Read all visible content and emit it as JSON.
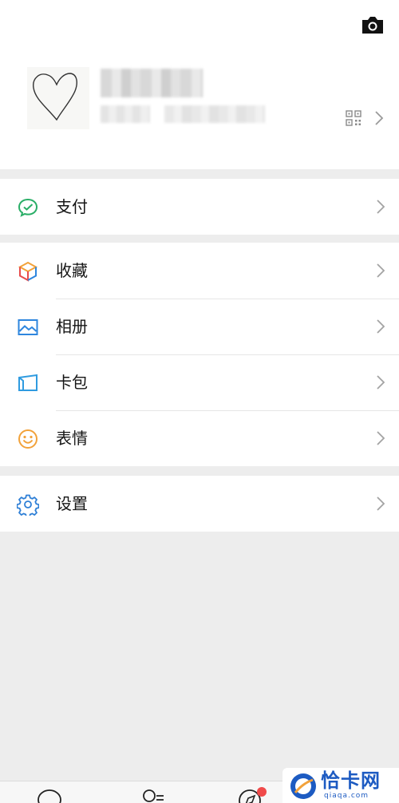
{
  "menu": {
    "pay": {
      "label": "支付",
      "icon": "wechat-pay-icon"
    },
    "favorites": {
      "label": "收藏",
      "icon": "cube-icon"
    },
    "album": {
      "label": "相册",
      "icon": "photo-icon"
    },
    "cards": {
      "label": "卡包",
      "icon": "card-icon"
    },
    "stickers": {
      "label": "表情",
      "icon": "smiley-icon"
    },
    "settings": {
      "label": "设置",
      "icon": "gear-icon"
    }
  },
  "watermark": {
    "text": "恰卡网",
    "subtext": "qiaqa.com"
  },
  "colors": {
    "background": "#ededed",
    "pay_green": "#2aae67",
    "album_blue": "#2e86de",
    "card_blue": "#2f9be0",
    "sticker_orange": "#f2a23a",
    "settings_blue": "#2e7fd6",
    "badge_red": "#f04a4a",
    "watermark_blue": "#1d5bc2"
  }
}
